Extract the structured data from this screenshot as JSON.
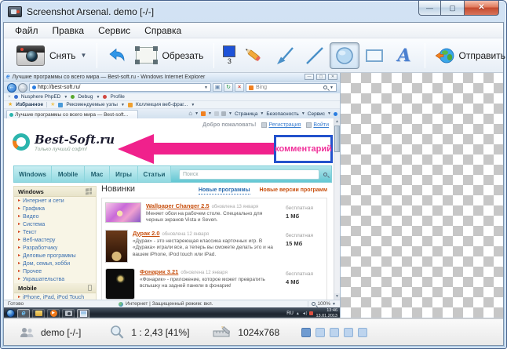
{
  "window": {
    "title": "Screenshot Arsenal. demo [-/-]"
  },
  "menu": {
    "items": [
      "Файл",
      "Правка",
      "Сервис",
      "Справка"
    ]
  },
  "toolbar": {
    "capture": "Снять",
    "crop": "Обрезать",
    "thickness": "3",
    "text_tool": "A",
    "send": "Отправить"
  },
  "browser": {
    "title": "Лучшие программы со всего мира — Best-soft.ru - Windows Internet Explorer",
    "url": "http://best-soft.ru/",
    "search_engine": "Bing",
    "dev_toolbar": [
      "Nusphere PhpED",
      "Debug",
      "Profile"
    ],
    "favorites_label": "Избранное",
    "favorites_items": [
      "Рекомендуемые узлы",
      "Коллекция веб-фраг..."
    ],
    "tab_title": "Лучшие программы со всего мира — Best-soft...",
    "command_bar": [
      "Страница",
      "Безопасность",
      "Сервис"
    ],
    "status_ready": "Готово",
    "status_zone": "Интернет | Защищенный режим: вкл.",
    "status_zoom": "100%"
  },
  "site": {
    "welcome": "Добро пожаловать!",
    "register": "Регистрация",
    "login": "Войти",
    "logo_title": "Best-Soft.ru",
    "logo_slogan": "Только лучший софт!",
    "annotation": "комментарий",
    "nav_tabs": [
      "Windows",
      "Mobile",
      "Mac",
      "Игры",
      "Статьи"
    ],
    "search_placeholder": "Поиск",
    "sidebar_sections": [
      {
        "title": "Windows",
        "items": [
          "Интернет и сети",
          "Графика",
          "Видео",
          "Система",
          "Текст",
          "Веб-мастеру",
          "Разработчику",
          "Деловые программы",
          "Дом, семья, хобби",
          "Прочее",
          "Украшательства"
        ]
      },
      {
        "title": "Mobile",
        "items": [
          "iPhone, iPad, iPod Touch"
        ]
      }
    ],
    "news_heading": "Новинки",
    "news_tabs": [
      "Новые программы",
      "Новые версии программ"
    ],
    "programs": [
      {
        "name": "Wallpaper Changer 2.5",
        "updated": "обновлена 13 января",
        "desc": "Меняет обои на рабочем столе. Специально для черных экранов Vista и Seven.",
        "license": "бесплатная",
        "size": "1 Мб"
      },
      {
        "name": "Дурак 2.0",
        "updated": "обновлена 12 января",
        "desc": "«Дурак» - это нестареющая классика карточных игр. В «Дурака» играли все, а теперь вы сможете делать это и на вашем iPhone, iPod touch или iPad.",
        "license": "бесплатная",
        "size": "15 Мб"
      },
      {
        "name": "Фонарик 3.21",
        "updated": "обновлена 12 января",
        "desc": "«Фонарик» - приложение, которое может превратить вспышку на задней панели в фонарик!",
        "license": "бесплатная",
        "size": "4 Мб"
      }
    ]
  },
  "taskbar": {
    "lang": "RU",
    "time": "13:46",
    "date": "13.01.2013"
  },
  "statusbar": {
    "user": "demo [-/-]",
    "scale": "1 : 2,43 [41%]",
    "resolution": "1024x768"
  },
  "colors": {
    "accent_pink": "#f0218c",
    "annotation_border": "#2352cc",
    "teal_nav": "#64c7d3",
    "link_blue": "#2b6cb0",
    "link_orange": "#c8500f"
  }
}
